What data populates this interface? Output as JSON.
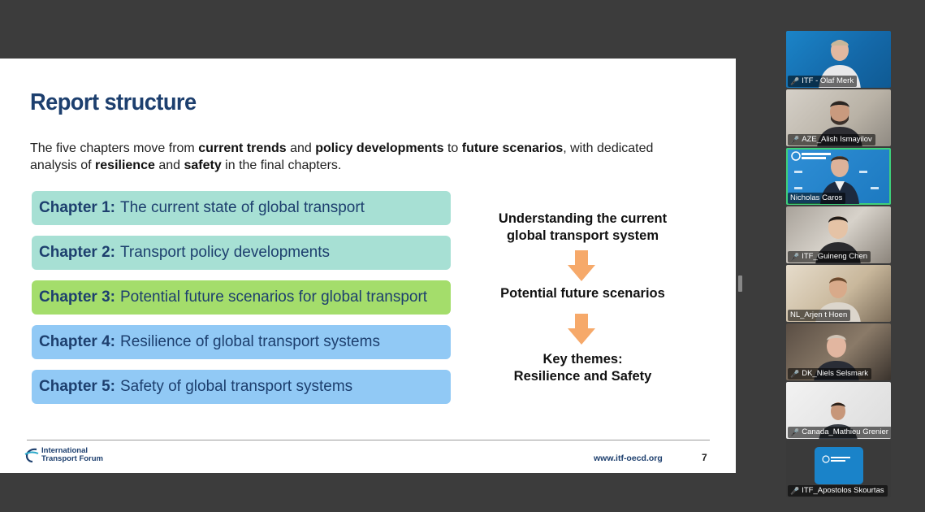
{
  "slide": {
    "title": "Report structure",
    "intro_parts": [
      {
        "text": "The five chapters move from ",
        "bold": false
      },
      {
        "text": "current trends",
        "bold": true
      },
      {
        "text": " and ",
        "bold": false
      },
      {
        "text": "policy developments",
        "bold": true
      },
      {
        "text": " to ",
        "bold": false
      },
      {
        "text": "future scenarios",
        "bold": true
      },
      {
        "text": ", with dedicated analysis of ",
        "bold": false
      },
      {
        "text": "resilience",
        "bold": true
      },
      {
        "text": " and ",
        "bold": false
      },
      {
        "text": "safety",
        "bold": true
      },
      {
        "text": " in the final chapters.",
        "bold": false
      }
    ],
    "chapters": [
      {
        "num": "Chapter 1:",
        "title": "The current state of global transport",
        "color": "#a7e0d4"
      },
      {
        "num": "Chapter 2:",
        "title": "Transport policy developments",
        "color": "#a7e0d4"
      },
      {
        "num": "Chapter 3:",
        "title": "Potential future scenarios for global transport",
        "color": "#a4dd6b"
      },
      {
        "num": "Chapter 4:",
        "title": "Resilience of global transport systems",
        "color": "#91c9f5"
      },
      {
        "num": "Chapter 5:",
        "title": "Safety of global transport systems",
        "color": "#91c9f5"
      }
    ],
    "flow": {
      "step1_line1": "Understanding the current",
      "step1_line2": "global transport system",
      "step2": "Potential future scenarios",
      "step3_line1": "Key themes:",
      "step3_line2": "Resilience and Safety",
      "arrow_color": "#f6a96a"
    },
    "footer": {
      "logo_line1": "International",
      "logo_line2": "Transport Forum",
      "url": "www.itf-oecd.org",
      "page_number": "7"
    }
  },
  "participants": [
    {
      "name": "ITF - Olaf Merk",
      "muted": true,
      "active": false
    },
    {
      "name": "AZE_Alish Ismayilov",
      "muted": true,
      "active": false
    },
    {
      "name": "Nicholas Caros",
      "muted": false,
      "active": true
    },
    {
      "name": "ITF_Guineng Chen",
      "muted": true,
      "active": false
    },
    {
      "name": "NL_Arjen t Hoen",
      "muted": false,
      "active": false
    },
    {
      "name": "DK_Niels Selsmark",
      "muted": true,
      "active": false
    },
    {
      "name": "Canada_Mathieu Grenier",
      "muted": true,
      "active": false
    },
    {
      "name": "ITF_Apostolos Skourtas",
      "muted": true,
      "active": false
    }
  ],
  "colors": {
    "title_navy": "#1d3f6e",
    "active_speaker_border": "#3fd07a",
    "muted_mic": "#ff5a5a"
  },
  "icons": {
    "muted_mic": "mic-muted-icon",
    "arrow": "down-arrow-icon",
    "logo": "itf-logo-icon"
  }
}
